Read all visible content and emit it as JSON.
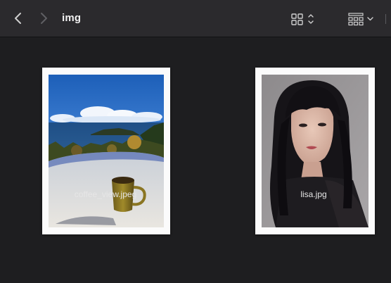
{
  "toolbar": {
    "title": "img",
    "back_icon": "chevron-left-icon",
    "forward_icon": "chevron-right-icon",
    "view_icon": "grid-view-icon",
    "group_icon": "group-by-icon"
  },
  "files": [
    {
      "name": "coffee_view.jpeg"
    },
    {
      "name": "lisa.jpg"
    }
  ],
  "colors": {
    "window_bg": "#1e1e20",
    "toolbar_bg": "#2b2a2d",
    "text": "#f0f0f0"
  }
}
